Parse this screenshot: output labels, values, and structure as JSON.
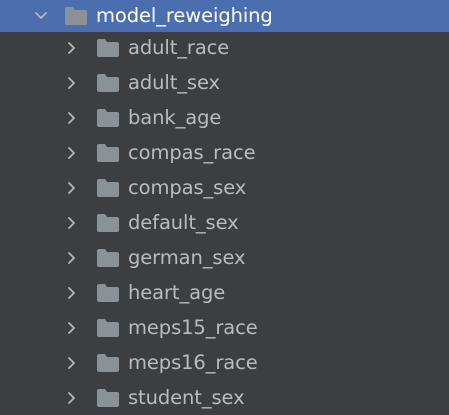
{
  "colors": {
    "panel_bg": "#3c3f41",
    "selected_bg": "#4b6eaf",
    "text": "#bbbbbb",
    "selected_text": "#ffffff",
    "folder": "#8a9197",
    "chevron": "#b6b6b6"
  },
  "tree": {
    "root": {
      "label": "model_reweighing",
      "expanded": true,
      "icon": "folder-icon",
      "toggle_icon": "chevron-down-icon"
    },
    "children": [
      {
        "label": "adult_race",
        "icon": "folder-icon",
        "toggle_icon": "chevron-right-icon"
      },
      {
        "label": "adult_sex",
        "icon": "folder-icon",
        "toggle_icon": "chevron-right-icon"
      },
      {
        "label": "bank_age",
        "icon": "folder-icon",
        "toggle_icon": "chevron-right-icon"
      },
      {
        "label": "compas_race",
        "icon": "folder-icon",
        "toggle_icon": "chevron-right-icon"
      },
      {
        "label": "compas_sex",
        "icon": "folder-icon",
        "toggle_icon": "chevron-right-icon"
      },
      {
        "label": "default_sex",
        "icon": "folder-icon",
        "toggle_icon": "chevron-right-icon"
      },
      {
        "label": "german_sex",
        "icon": "folder-icon",
        "toggle_icon": "chevron-right-icon"
      },
      {
        "label": "heart_age",
        "icon": "folder-icon",
        "toggle_icon": "chevron-right-icon"
      },
      {
        "label": "meps15_race",
        "icon": "folder-icon",
        "toggle_icon": "chevron-right-icon"
      },
      {
        "label": "meps16_race",
        "icon": "folder-icon",
        "toggle_icon": "chevron-right-icon"
      },
      {
        "label": "student_sex",
        "icon": "folder-icon",
        "toggle_icon": "chevron-right-icon"
      }
    ]
  }
}
